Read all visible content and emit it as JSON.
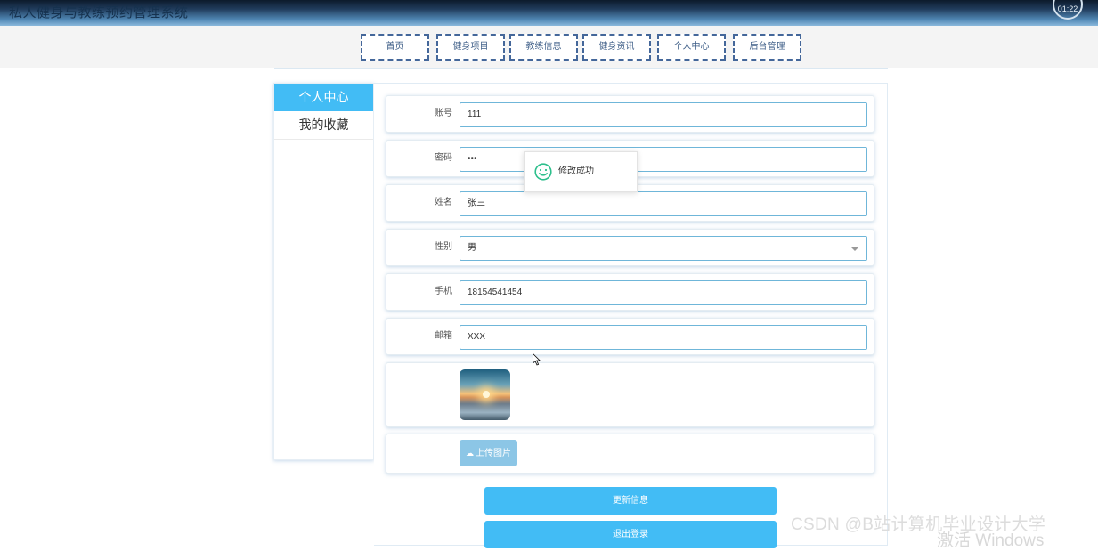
{
  "header": {
    "site_title": "私人健身与教练预约管理系统",
    "clock_text": "01:22"
  },
  "nav": {
    "items": [
      "首页",
      "健身项目",
      "教练信息",
      "健身资讯",
      "个人中心",
      "后台管理"
    ]
  },
  "sidebar": {
    "items": [
      {
        "label": "个人中心",
        "active": true
      },
      {
        "label": "我的收藏",
        "active": false
      }
    ]
  },
  "form": {
    "account": {
      "label": "账号",
      "value": "111"
    },
    "password": {
      "label": "密码",
      "value": "•••"
    },
    "name": {
      "label": "姓名",
      "value": "张三"
    },
    "gender": {
      "label": "性别",
      "value": "男"
    },
    "phone": {
      "label": "手机",
      "value": "18154541454"
    },
    "email": {
      "label": "邮箱",
      "value": "XXX"
    },
    "upload_label": "上传图片"
  },
  "buttons": {
    "update": "更新信息",
    "logout": "退出登录"
  },
  "toast": {
    "message": "修改成功"
  },
  "watermark": {
    "csdn": "CSDN @B站计算机毕业设计大学",
    "windows": "激活 Windows"
  },
  "colors": {
    "accent": "#42bcf5",
    "nav_border": "#44679a",
    "toast_icon": "#2dbf8c"
  }
}
